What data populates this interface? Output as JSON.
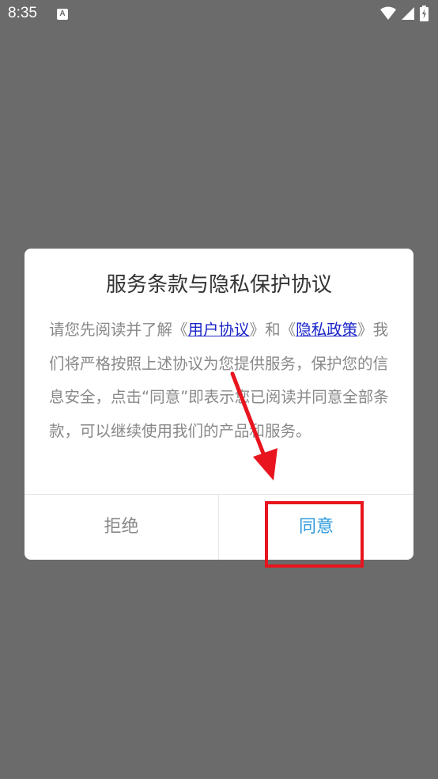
{
  "status_bar": {
    "time": "8:35",
    "notification_icon_label": "A"
  },
  "dialog": {
    "title": "服务条款与隐私保护协议",
    "body_part1": "请您先阅读并了解",
    "open_quote1": "《",
    "link_user_agreement": "用户协议",
    "close_quote1": "》",
    "and_text": "和",
    "open_quote2": "《",
    "link_privacy_policy": "隐私政策",
    "close_quote2": "》",
    "body_part2": "我们将严格按照上述协议为您提供服务，保护您的信息安全，点击“同意”即表示您已阅读并同意全部条款，可以继续使用我们的产品和服务。",
    "reject_label": "拒绝",
    "agree_label": "同意"
  },
  "colors": {
    "overlay": "#6b6b6b",
    "link": "#1a24c8",
    "agree": "#2e9bdc",
    "annotation": "#e8141e"
  }
}
